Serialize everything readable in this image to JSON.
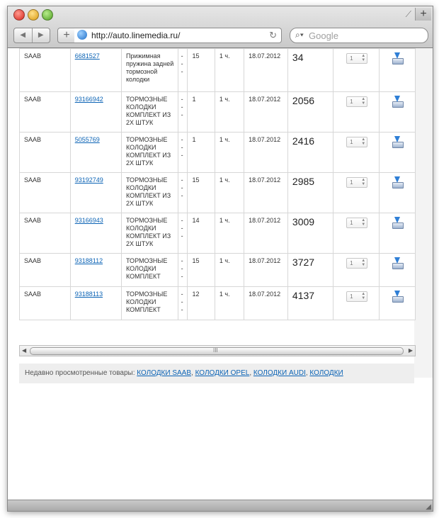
{
  "browser": {
    "url": "http://auto.linemedia.ru/",
    "search_placeholder": "Google",
    "back_glyph": "◀",
    "forward_glyph": "▶",
    "add_glyph": "+",
    "reload_glyph": "↻",
    "newtab_glyph": "+"
  },
  "table": {
    "rows": [
      {
        "brand": "SAAB",
        "code": "6681527",
        "desc": "Прижимная пружина задней тормозной колодки",
        "dash": "-\n-\n-",
        "qty": "15",
        "time": "1 ч.",
        "date": "18.07.2012",
        "price": "34",
        "amount": "1"
      },
      {
        "brand": "SAAB",
        "code": "93166942",
        "desc": "ТОРМОЗНЫЕ КОЛОДКИ КОМПЛЕКТ ИЗ 2Х ШТУК",
        "dash": "-\n-\n-",
        "qty": "1",
        "time": "1 ч.",
        "date": "18.07.2012",
        "price": "2056",
        "amount": "1"
      },
      {
        "brand": "SAAB",
        "code": "5055769",
        "desc": "ТОРМОЗНЫЕ КОЛОДКИ КОМПЛЕКТ ИЗ 2Х ШТУК",
        "dash": "-\n-\n-",
        "qty": "1",
        "time": "1 ч.",
        "date": "18.07.2012",
        "price": "2416",
        "amount": "1"
      },
      {
        "brand": "SAAB",
        "code": "93192749",
        "desc": "ТОРМОЗНЫЕ КОЛОДКИ КОМПЛЕКТ ИЗ 2Х ШТУК",
        "dash": "-\n-\n-",
        "qty": "15",
        "time": "1 ч.",
        "date": "18.07.2012",
        "price": "2985",
        "amount": "1"
      },
      {
        "brand": "SAAB",
        "code": "93166943",
        "desc": "ТОРМОЗНЫЕ КОЛОДКИ КОМПЛЕКТ ИЗ 2Х ШТУК",
        "dash": "-\n-\n-",
        "qty": "14",
        "time": "1 ч.",
        "date": "18.07.2012",
        "price": "3009",
        "amount": "1"
      },
      {
        "brand": "SAAB",
        "code": "93188112",
        "desc": "ТОРМОЗНЫЕ КОЛОДКИ КОМПЛЕКТ",
        "dash": "-\n-\n-",
        "qty": "15",
        "time": "1 ч.",
        "date": "18.07.2012",
        "price": "3727",
        "amount": "1"
      },
      {
        "brand": "SAAB",
        "code": "93188113",
        "desc": "ТОРМОЗНЫЕ КОЛОДКИ КОМПЛЕКТ",
        "dash": "-\n-\n-",
        "qty": "12",
        "time": "1 ч.",
        "date": "18.07.2012",
        "price": "4137",
        "amount": "1"
      }
    ]
  },
  "scrollbar": {
    "grip": "III",
    "left": "◀",
    "right": "▶"
  },
  "recent": {
    "label": "Недавно просмотренные товары:",
    "links": [
      "КОЛОДКИ SAAB",
      "КОЛОДКИ OPEL",
      "КОЛОДКИ AUDI",
      "КОЛОДКИ"
    ]
  },
  "icons": {
    "cart": "add-to-cart-icon",
    "globe": "globe-icon",
    "search": "search-icon"
  }
}
